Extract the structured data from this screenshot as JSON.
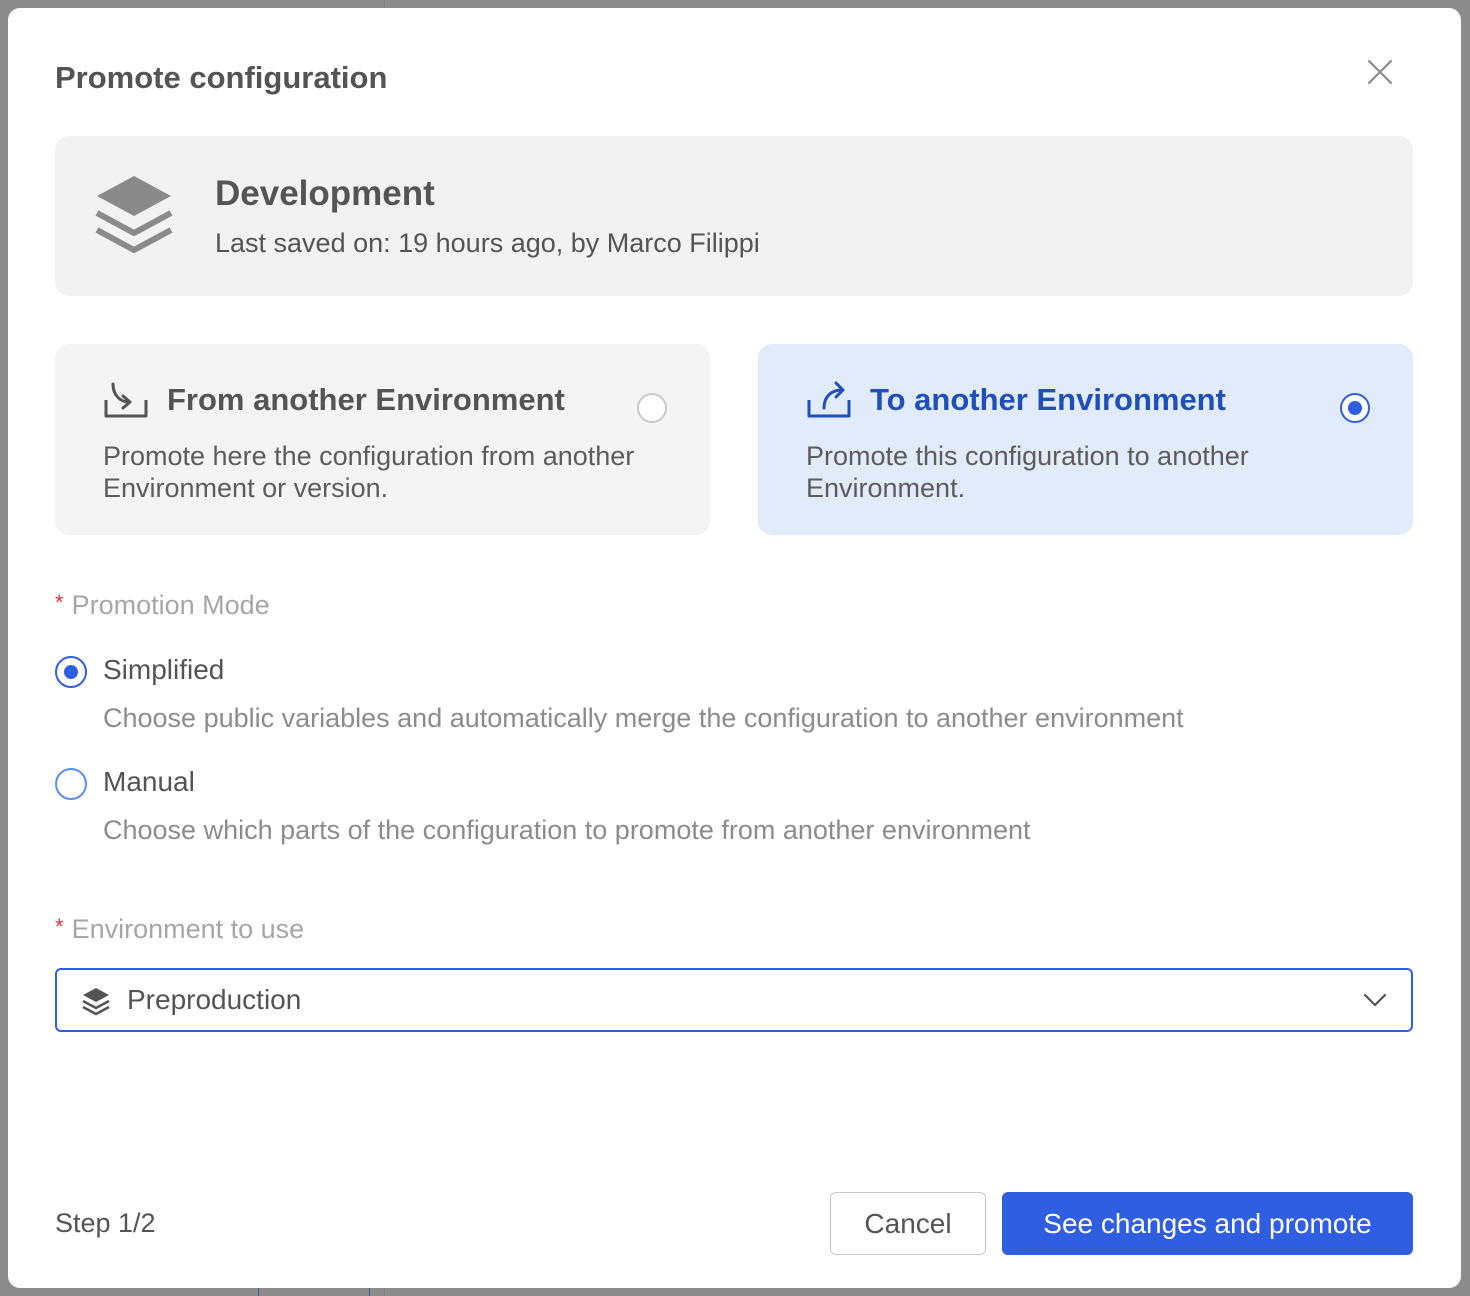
{
  "dialog": {
    "title": "Promote configuration"
  },
  "current_environment": {
    "name": "Development",
    "last_saved": "Last saved on: 19 hours ago, by Marco Filippi",
    "icon": "layers-icon"
  },
  "direction_options": [
    {
      "title": "From another Environment",
      "description": "Promote here the configuration from another Environment or version.",
      "icon": "download-tray-icon",
      "selected": false
    },
    {
      "title": "To another Environment",
      "description": "Promote this configuration to another Environment.",
      "icon": "share-out-icon",
      "selected": true
    }
  ],
  "promotion_mode": {
    "label": "Promotion Mode",
    "required_marker": "*",
    "options": [
      {
        "label": "Simplified",
        "description": "Choose public variables and automatically merge the configuration to another environment",
        "selected": true
      },
      {
        "label": "Manual",
        "description": "Choose which parts of the configuration to promote from another environment",
        "selected": false
      }
    ]
  },
  "environment_select": {
    "label": "Environment to use",
    "required_marker": "*",
    "value": "Preproduction",
    "icon": "layers-icon"
  },
  "footer": {
    "step": "Step 1/2",
    "cancel_label": "Cancel",
    "primary_label": "See changes and promote"
  },
  "colors": {
    "accent": "#2f5ee0",
    "selected_card_bg": "#e1ebfb",
    "selected_card_text": "#1f4fb8",
    "required": "#d83a3a"
  }
}
